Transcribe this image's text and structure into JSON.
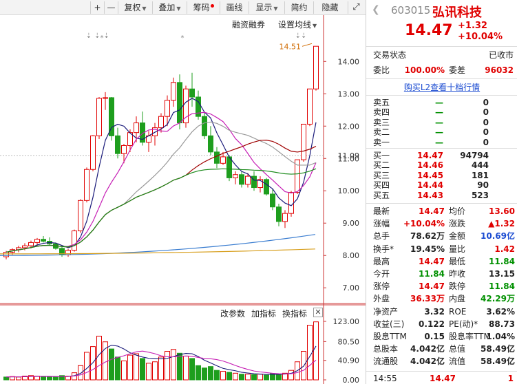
{
  "toolbar": {
    "plus": "+",
    "minus": "—",
    "fuquan": "复权",
    "diejia": "叠加",
    "chouma": "筹码",
    "huaxian": "画线",
    "xianshi": "显示",
    "jianyue": "简约",
    "yincang": "隐藏"
  },
  "chart": {
    "menu_rzrq": "融资融券",
    "menu_settings": "设置均线",
    "price_axis": [
      "14.00",
      "13.00",
      "12.00",
      "11.00",
      "10.00",
      "9.00",
      "8.00",
      "7.00"
    ],
    "current_price_tag": "11.09",
    "high_annotation": "14.51",
    "vol_menu": [
      "改参数",
      "加指标",
      "换指标"
    ],
    "vol_axis": [
      "123.00",
      "80.50",
      "40.90",
      "0.00"
    ]
  },
  "chart_data": {
    "type": "candlestick",
    "ylim": [
      6.6,
      14.9
    ],
    "vol_max": 123.0,
    "candles": [
      [
        7.96,
        8.14,
        7.88,
        8.1
      ],
      [
        8.1,
        8.22,
        8.02,
        8.18
      ],
      [
        8.18,
        8.3,
        8.1,
        8.24
      ],
      [
        8.24,
        8.38,
        8.16,
        8.3
      ],
      [
        8.3,
        8.46,
        8.22,
        8.4
      ],
      [
        8.4,
        8.54,
        8.3,
        8.5
      ],
      [
        8.5,
        8.6,
        8.4,
        8.44
      ],
      [
        8.44,
        8.56,
        8.3,
        8.36
      ],
      [
        8.36,
        8.4,
        8.18,
        8.22
      ],
      [
        8.22,
        8.3,
        7.96,
        8.02
      ],
      [
        8.02,
        8.2,
        7.96,
        8.16
      ],
      [
        8.16,
        8.8,
        8.12,
        8.76
      ],
      [
        8.76,
        9.74,
        8.7,
        9.7
      ],
      [
        9.7,
        10.72,
        9.64,
        10.66
      ],
      [
        10.66,
        11.72,
        10.6,
        11.7
      ],
      [
        11.7,
        12.9,
        11.6,
        12.86
      ],
      [
        12.86,
        13.05,
        12.5,
        12.88
      ],
      [
        12.88,
        12.9,
        11.55,
        11.7
      ],
      [
        11.7,
        11.95,
        11.0,
        11.15
      ],
      [
        11.15,
        11.45,
        10.85,
        11.4
      ],
      [
        11.4,
        11.9,
        11.2,
        11.8
      ],
      [
        11.8,
        12.3,
        11.5,
        12.1
      ],
      [
        12.1,
        12.45,
        11.4,
        11.5
      ],
      [
        11.5,
        11.85,
        11.2,
        11.7
      ],
      [
        11.7,
        12.1,
        11.4,
        11.95
      ],
      [
        11.95,
        12.4,
        11.8,
        12.3
      ],
      [
        12.3,
        12.95,
        12.0,
        12.8
      ],
      [
        12.8,
        13.5,
        12.6,
        13.35
      ],
      [
        13.35,
        13.6,
        11.9,
        12.1
      ],
      [
        12.1,
        13.25,
        11.95,
        13.15
      ],
      [
        13.15,
        13.65,
        12.6,
        12.9
      ],
      [
        12.9,
        13.1,
        12.2,
        12.3
      ],
      [
        12.3,
        12.45,
        11.6,
        11.7
      ],
      [
        11.7,
        12.0,
        11.1,
        11.2
      ],
      [
        11.2,
        11.35,
        10.7,
        10.85
      ],
      [
        10.85,
        11.2,
        10.8,
        11.05
      ],
      [
        11.05,
        11.1,
        10.3,
        10.4
      ],
      [
        10.4,
        10.6,
        10.2,
        10.5
      ],
      [
        10.5,
        10.6,
        10.1,
        10.2
      ],
      [
        10.2,
        10.55,
        10.1,
        10.45
      ],
      [
        10.45,
        10.6,
        10.0,
        10.1
      ],
      [
        10.1,
        10.45,
        9.95,
        10.35
      ],
      [
        10.35,
        10.4,
        9.85,
        9.9
      ],
      [
        9.9,
        10.05,
        9.4,
        9.5
      ],
      [
        9.5,
        9.6,
        8.9,
        9.05
      ],
      [
        9.05,
        9.4,
        8.85,
        9.3
      ],
      [
        9.3,
        10.0,
        9.2,
        9.95
      ],
      [
        9.95,
        10.96,
        9.9,
        10.96
      ],
      [
        10.96,
        12.06,
        10.9,
        12.06
      ],
      [
        12.06,
        13.15,
        12.0,
        13.15
      ],
      [
        13.15,
        14.47,
        13.1,
        14.47
      ]
    ],
    "volumes": [
      [
        6,
        "g"
      ],
      [
        7,
        "r"
      ],
      [
        6,
        "r"
      ],
      [
        8,
        "r"
      ],
      [
        9,
        "r"
      ],
      [
        8,
        "r"
      ],
      [
        7,
        "g"
      ],
      [
        6,
        "g"
      ],
      [
        6,
        "g"
      ],
      [
        9,
        "g"
      ],
      [
        8,
        "r"
      ],
      [
        15,
        "r"
      ],
      [
        30,
        "r"
      ],
      [
        58,
        "r"
      ],
      [
        70,
        "r"
      ],
      [
        92,
        "r"
      ],
      [
        80,
        "r"
      ],
      [
        65,
        "g"
      ],
      [
        48,
        "g"
      ],
      [
        40,
        "r"
      ],
      [
        52,
        "r"
      ],
      [
        55,
        "r"
      ],
      [
        45,
        "g"
      ],
      [
        35,
        "r"
      ],
      [
        38,
        "r"
      ],
      [
        48,
        "r"
      ],
      [
        60,
        "r"
      ],
      [
        64,
        "r"
      ],
      [
        56,
        "g"
      ],
      [
        50,
        "r"
      ],
      [
        45,
        "g"
      ],
      [
        30,
        "g"
      ],
      [
        25,
        "g"
      ],
      [
        28,
        "g"
      ],
      [
        20,
        "g"
      ],
      [
        18,
        "r"
      ],
      [
        16,
        "g"
      ],
      [
        14,
        "r"
      ],
      [
        12,
        "g"
      ],
      [
        12,
        "r"
      ],
      [
        11,
        "g"
      ],
      [
        12,
        "r"
      ],
      [
        10,
        "g"
      ],
      [
        13,
        "g"
      ],
      [
        12,
        "g"
      ],
      [
        14,
        "r"
      ],
      [
        20,
        "r"
      ],
      [
        38,
        "r"
      ],
      [
        60,
        "r"
      ],
      [
        115,
        "r"
      ],
      [
        122,
        "r"
      ]
    ]
  },
  "panel": {
    "code": "603015",
    "name": "弘讯科技",
    "price": "14.47",
    "change": "+1.32",
    "change_pct": "+10.04%",
    "trade_status_label": "交易状态",
    "trade_status": "已收市",
    "weibi_label": "委比",
    "weibi": "100.00%",
    "weicha_label": "委差",
    "weicha": "96032",
    "l2_link": "购买L2查看十档行情",
    "sell": [
      {
        "label": "卖五",
        "price": "—",
        "vol": "0"
      },
      {
        "label": "卖四",
        "price": "—",
        "vol": "0"
      },
      {
        "label": "卖三",
        "price": "—",
        "vol": "0"
      },
      {
        "label": "卖二",
        "price": "—",
        "vol": "0"
      },
      {
        "label": "卖一",
        "price": "—",
        "vol": "0"
      }
    ],
    "buy": [
      {
        "label": "买一",
        "price": "14.47",
        "vol": "94794"
      },
      {
        "label": "买二",
        "price": "14.46",
        "vol": "444"
      },
      {
        "label": "买三",
        "price": "14.45",
        "vol": "181"
      },
      {
        "label": "买四",
        "price": "14.44",
        "vol": "90"
      },
      {
        "label": "买五",
        "price": "14.43",
        "vol": "523"
      }
    ],
    "stats": [
      {
        "l1": "最新",
        "v1": "14.47",
        "c1": "red",
        "l2": "均价",
        "v2": "13.60",
        "c2": "red"
      },
      {
        "l1": "涨幅",
        "v1": "+10.04%",
        "c1": "red",
        "l2": "涨跌",
        "v2": "▲1.32",
        "c2": "red"
      },
      {
        "l1": "总手",
        "v1": "78.62万",
        "c1": "",
        "l2": "金额",
        "v2": "10.69亿",
        "c2": "blue"
      },
      {
        "l1": "换手*",
        "v1": "19.45%",
        "c1": "",
        "l2": "量比",
        "v2": "1.42",
        "c2": "red"
      },
      {
        "l1": "最高",
        "v1": "14.47",
        "c1": "red",
        "l2": "最低",
        "v2": "11.84",
        "c2": "green"
      },
      {
        "l1": "今开",
        "v1": "11.84",
        "c1": "green",
        "l2": "昨收",
        "v2": "13.15",
        "c2": ""
      },
      {
        "l1": "涨停",
        "v1": "14.47",
        "c1": "red",
        "l2": "跌停",
        "v2": "11.84",
        "c2": "green"
      },
      {
        "l1": "外盘",
        "v1": "36.33万",
        "c1": "red",
        "l2": "内盘",
        "v2": "42.29万",
        "c2": "green"
      },
      {
        "l1": "净资产",
        "v1": "3.32",
        "c1": "",
        "l2": "ROE",
        "v2": "3.62%",
        "c2": ""
      },
      {
        "l1": "收益(三)",
        "v1": "0.122",
        "c1": "",
        "l2": "PE(动)*",
        "v2": "88.73",
        "c2": ""
      },
      {
        "l1": "股息TTM",
        "v1": "0.15",
        "c1": "",
        "l2": "股息率TTM",
        "v2": "1.04%",
        "c2": ""
      },
      {
        "l1": "总股本",
        "v1": "4.042亿",
        "c1": "",
        "l2": "总值",
        "v2": "58.49亿",
        "c2": ""
      },
      {
        "l1": "流通股",
        "v1": "4.042亿",
        "c1": "",
        "l2": "流值",
        "v2": "58.49亿",
        "c2": ""
      }
    ],
    "tick": {
      "time": "14:55",
      "price": "14.47",
      "vol": "1"
    }
  },
  "colors": {
    "up": "#e00000",
    "down": "#1e9e1e",
    "blue": "#1a4bd1"
  }
}
